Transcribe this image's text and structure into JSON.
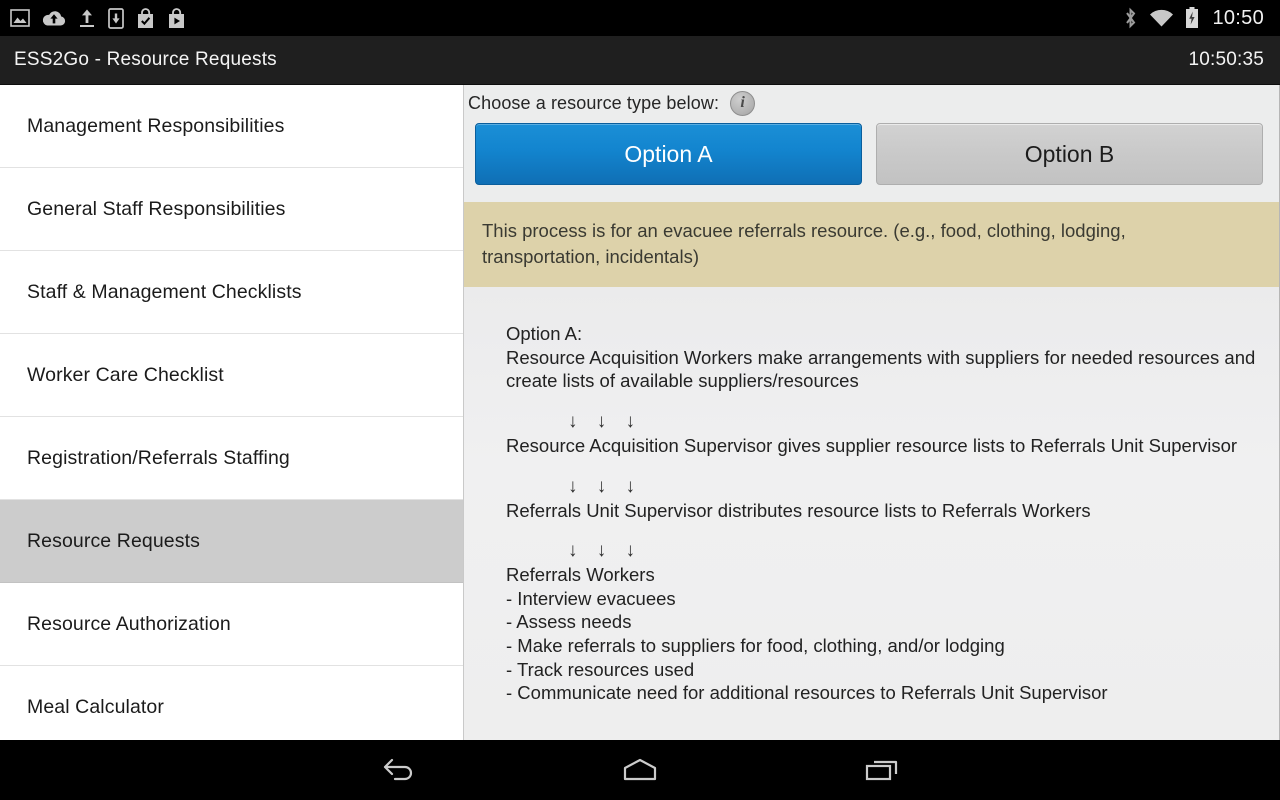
{
  "status_bar": {
    "icons": [
      "photo-icon",
      "cloud-upload-icon",
      "upload-icon",
      "download-to-device-icon",
      "store-checkmark-icon",
      "store-play-icon"
    ],
    "right_icons": [
      "bluetooth-icon",
      "wifi-icon",
      "battery-charging-icon"
    ],
    "clock": "10:50"
  },
  "action_bar": {
    "title": "ESS2Go - Resource Requests",
    "clock": "10:50:35"
  },
  "sidebar": {
    "items": [
      {
        "label": "Management Responsibilities",
        "selected": false
      },
      {
        "label": "General Staff Responsibilities",
        "selected": false
      },
      {
        "label": "Staff & Management Checklists",
        "selected": false
      },
      {
        "label": "Worker Care Checklist",
        "selected": false
      },
      {
        "label": "Registration/Referrals Staffing",
        "selected": false
      },
      {
        "label": "Resource Requests",
        "selected": true
      },
      {
        "label": "Resource Authorization",
        "selected": false
      },
      {
        "label": "Meal Calculator",
        "selected": false
      }
    ]
  },
  "panel": {
    "chooser_label": "Choose a resource type below:",
    "info_icon_glyph": "i",
    "options": [
      {
        "label": "Option A",
        "selected": true
      },
      {
        "label": "Option B",
        "selected": false
      }
    ],
    "banner_text": "This process is for an evacuee referrals resource. (e.g., food, clothing, lodging, transportation, incidentals)",
    "arrows": "↓ ↓ ↓",
    "flow": {
      "heading": "Option A:",
      "step1": "Resource Acquisition Workers make arrangements with suppliers for needed resources and create lists of available suppliers/resources",
      "step2": "Resource Acquisition Supervisor gives supplier resource lists to Referrals Unit Supervisor",
      "step3": "Referrals Unit Supervisor distributes resource lists to Referrals Workers",
      "step4_title": "Referrals Workers",
      "step4_bullets": [
        "- Interview evacuees",
        "- Assess needs",
        "- Make referrals to suppliers for food, clothing, and/or lodging",
        "- Track resources used",
        "- Communicate need for additional resources to Referrals Unit Supervisor"
      ]
    }
  },
  "nav_bar": {
    "buttons": [
      "back-button",
      "home-button",
      "recents-button"
    ]
  },
  "colors": {
    "accent_blue": "#1385cf",
    "banner_tan": "#ddd2aa",
    "selected_row": "#cccccc",
    "panel_bg": "#eceded",
    "action_bar_bg": "#1f1f1f"
  }
}
